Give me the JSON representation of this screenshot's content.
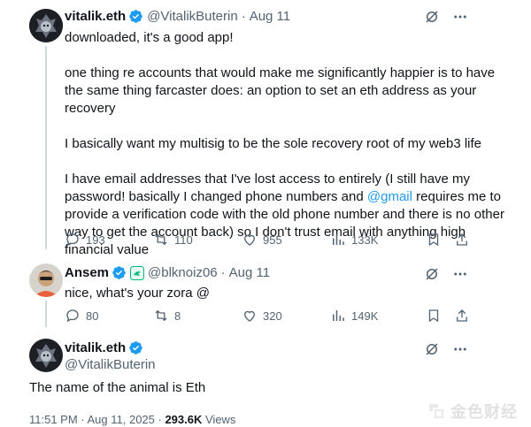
{
  "tweet1": {
    "name": "vitalik.eth",
    "handle": "@VitalikButerin",
    "date": "Aug 11",
    "dot": "·",
    "paragraphs": [
      "downloaded, it's a good app!",
      "one thing re accounts that would make me significantly happier is to have the same thing farcaster does: an option to set an eth address as your recovery",
      "I basically want my multisig to be the sole recovery root of my web3 life"
    ],
    "para4_before": "I have email addresses that I've lost access to entirely (I still have my password! basically I changed phone numbers and ",
    "para4_mention": "@gmail",
    "para4_after": " requires me to provide a verification code with the old phone number and there is no other way to get the account back) so I don't trust email with anything high financial value",
    "replies": "193",
    "reposts": "110",
    "likes": "955",
    "views": "133K"
  },
  "tweet2": {
    "name": "Ansem",
    "handle": "@blknoiz06",
    "date": "Aug 11",
    "dot": "·",
    "text": "nice, what's your zora @",
    "replies": "80",
    "reposts": "8",
    "likes": "320",
    "views": "149K"
  },
  "main_tweet": {
    "name": "vitalik.eth",
    "handle": "@VitalikButerin",
    "text": "The name of the animal is Eth",
    "time": "11:51 PM · Aug 11, 2025 · ",
    "views_count": "293.6K",
    "views_label": " Views"
  },
  "watermark": {
    "text": "金色财经"
  },
  "colors": {
    "accent": "#1d9bf0",
    "muted": "#536471",
    "verified": "#1d9bf0",
    "ansem_badge": "#00ba7c"
  }
}
